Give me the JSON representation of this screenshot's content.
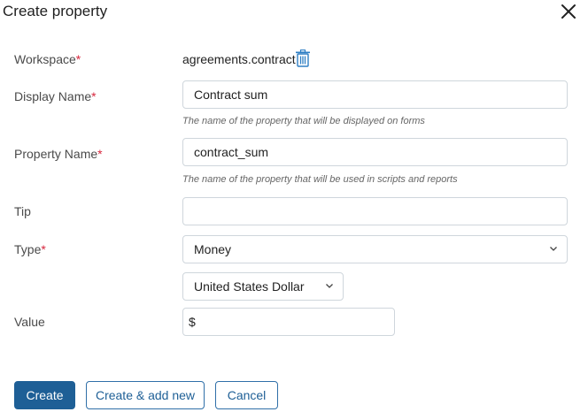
{
  "dialog": {
    "title": "Create property"
  },
  "fields": {
    "workspace": {
      "label": "Workspace",
      "value": "agreements.contract"
    },
    "display_name": {
      "label": "Display Name",
      "value": "Contract sum",
      "hint": "The name of the property that will be displayed on forms"
    },
    "property_name": {
      "label": "Property Name",
      "value": "contract_sum",
      "hint": "The name of the property that will be used in scripts and reports"
    },
    "tip": {
      "label": "Tip",
      "value": ""
    },
    "type": {
      "label": "Type",
      "value": "Money"
    },
    "currency": {
      "value": "United States Dollar"
    },
    "value": {
      "label": "Value",
      "prefix": "$"
    }
  },
  "required_mark": "*",
  "buttons": {
    "create": "Create",
    "create_add": "Create & add new",
    "cancel": "Cancel"
  },
  "colors": {
    "primary": "#1e5f96",
    "required": "#d7263d",
    "border": "#cfd6dc"
  },
  "icons": {
    "close": "close-icon",
    "trash": "trash-icon",
    "chevron": "chevron-down-icon"
  }
}
